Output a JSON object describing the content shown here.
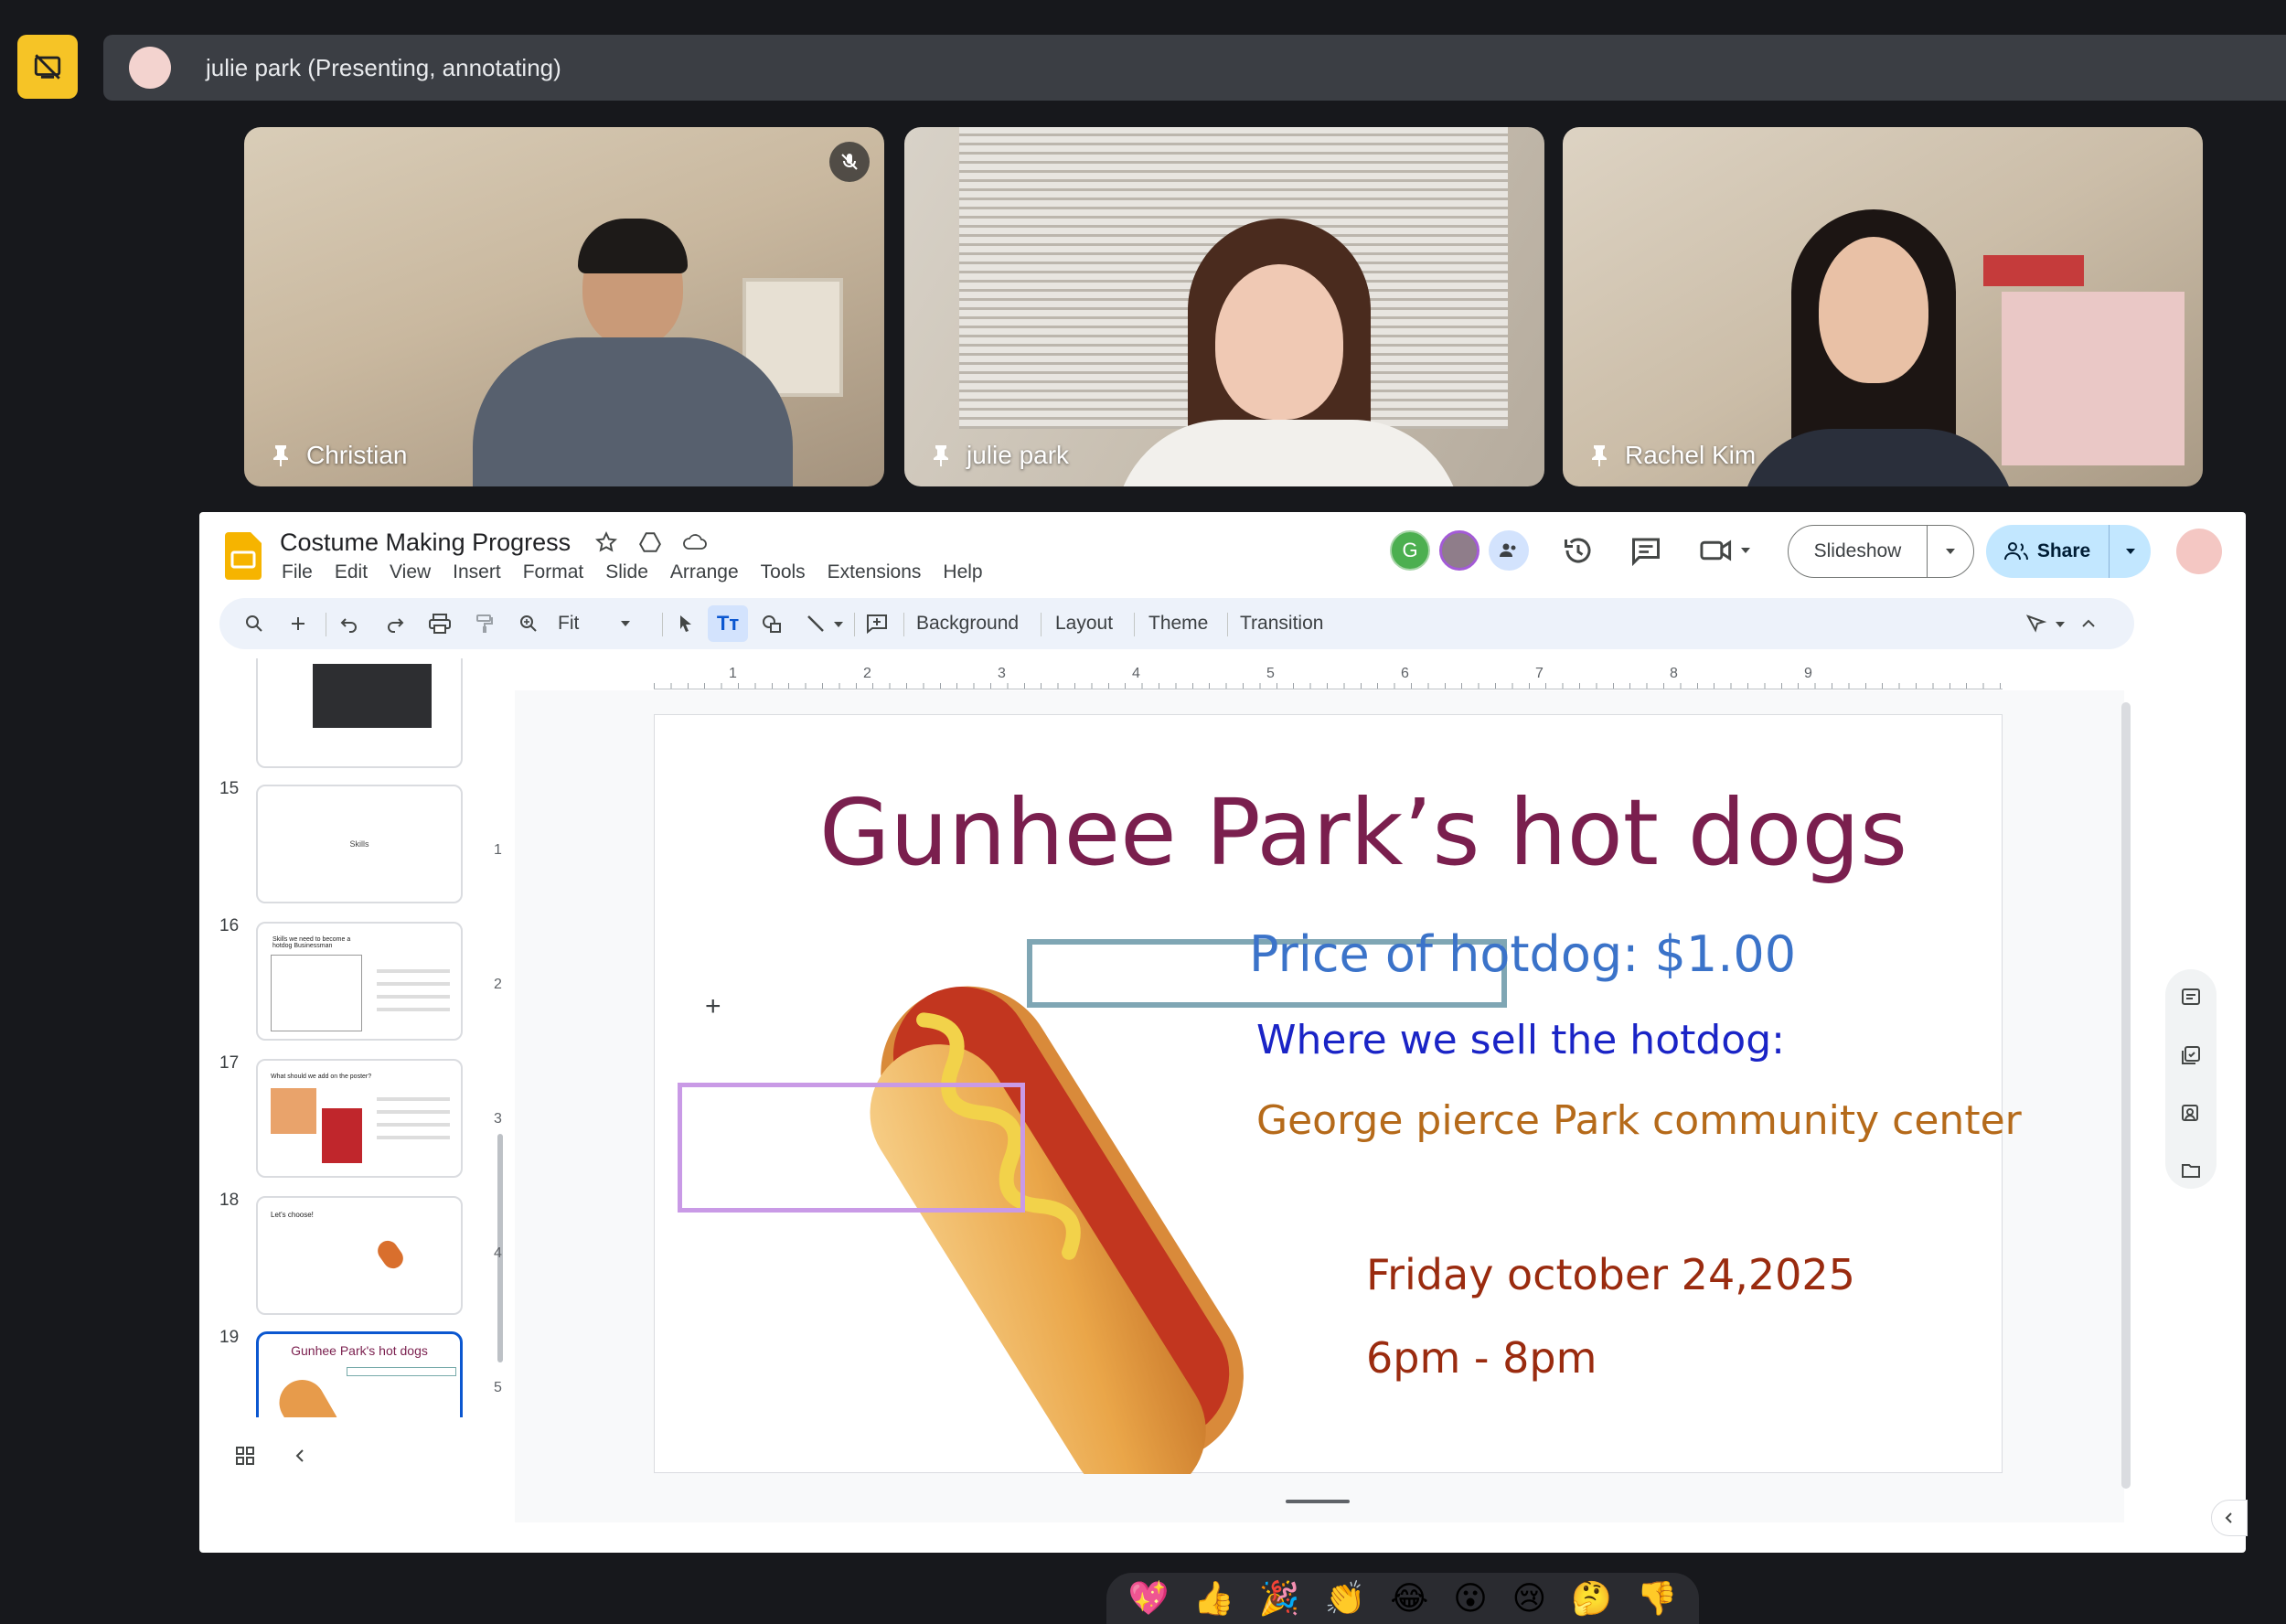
{
  "presenting": {
    "text": "julie park (Presenting, annotating)"
  },
  "participants": [
    {
      "name": "Christian"
    },
    {
      "name": "julie park"
    },
    {
      "name": "Rachel Kim"
    }
  ],
  "slides_app": {
    "doc_title": "Costume Making Progress",
    "menu": [
      "File",
      "Edit",
      "View",
      "Insert",
      "Format",
      "Slide",
      "Arrange",
      "Tools",
      "Extensions",
      "Help"
    ],
    "collab_avatar_letter": "G",
    "slideshow_label": "Slideshow",
    "share_label": "Share",
    "toolbar": {
      "zoom": "Fit",
      "background": "Background",
      "layout": "Layout",
      "theme": "Theme",
      "transition": "Transition"
    },
    "ruler_numbers": [
      "1",
      "2",
      "3",
      "4",
      "5",
      "6",
      "7",
      "8",
      "9"
    ],
    "vruler_numbers": [
      "1",
      "2",
      "3",
      "4",
      "5"
    ],
    "thumbnails": [
      {
        "num": "15",
        "text": "Skills"
      },
      {
        "num": "16",
        "text": "Skills we need to become a hotdog Businessman"
      },
      {
        "num": "17",
        "text": "What should we add on the poster?"
      },
      {
        "num": "18",
        "text": "Let's choose!"
      },
      {
        "num": "19",
        "text": "Gunhee Park's hot dogs"
      }
    ]
  },
  "slide": {
    "title": "Gunhee Park’s hot dogs",
    "price": "Price of hotdog: $1.00",
    "where": "Where we sell the hotdog:",
    "place": "George pierce Park community center",
    "date": "Friday october 24,2025",
    "time": "6pm - 8pm"
  },
  "reactions": [
    "💖",
    "👍",
    "🎉",
    "👏",
    "😂",
    "😮",
    "😢",
    "🤔",
    "👎"
  ]
}
